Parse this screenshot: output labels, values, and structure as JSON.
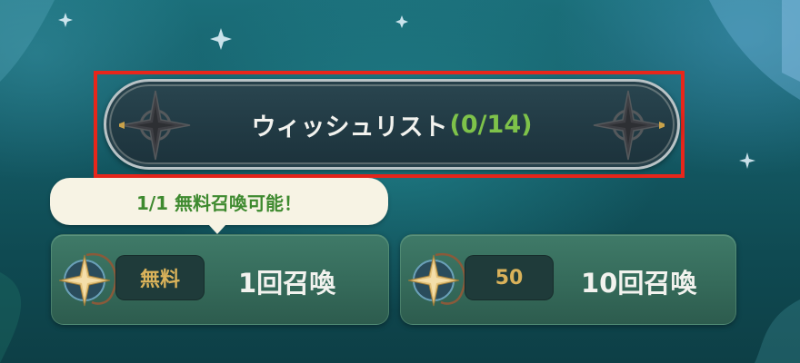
{
  "wishlist": {
    "label": "ウィッシュリスト",
    "count": "(0/14)"
  },
  "tooltip": {
    "text": "1/1 無料召喚可能！"
  },
  "summon_single": {
    "cost": "無料",
    "label": "1回召喚"
  },
  "summon_ten": {
    "cost": "50",
    "label": "10回召喚"
  },
  "colors": {
    "highlight": "#e8261b",
    "count_green": "#7ec24a",
    "tooltip_text": "#3e8a2f",
    "cost_gold": "#d9b25a",
    "button_teal": "#356a5a"
  },
  "icons": {
    "wishlist_decoration": "compass-star-icon",
    "currency": "summon-star-medal-icon"
  }
}
